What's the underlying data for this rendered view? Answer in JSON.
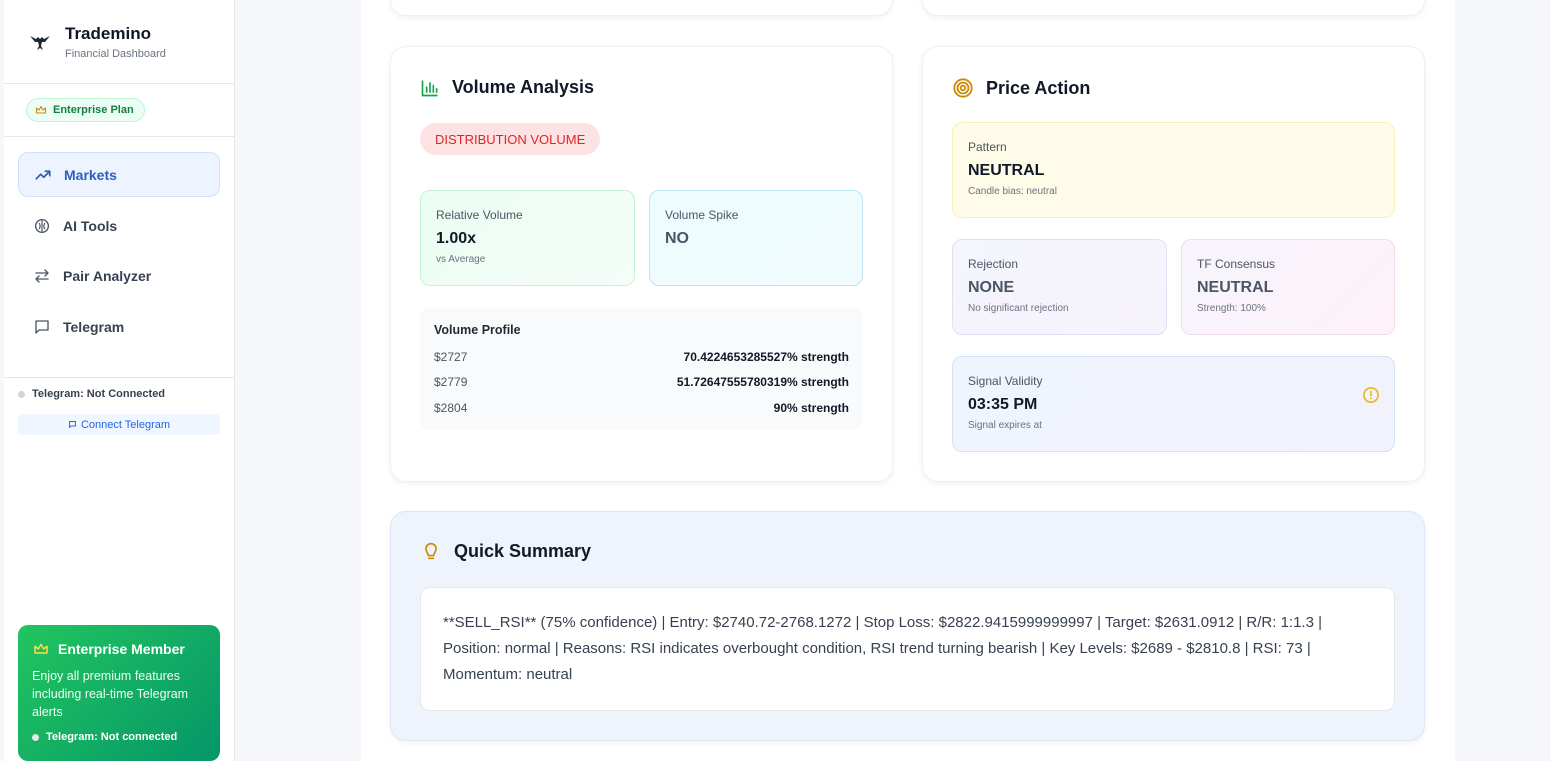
{
  "app": {
    "name": "Trademino",
    "subtitle": "Financial Dashboard",
    "plan_badge": "Enterprise Plan"
  },
  "sidebar": {
    "items": [
      {
        "label": "Markets",
        "icon": "trending-up-icon",
        "active": true
      },
      {
        "label": "AI Tools",
        "icon": "brain-icon",
        "active": false
      },
      {
        "label": "Pair Analyzer",
        "icon": "arrows-swap-icon",
        "active": false
      },
      {
        "label": "Telegram",
        "icon": "message-square-icon",
        "active": false
      }
    ],
    "telegram_status": "Telegram: Not Connected",
    "connect_label": "Connect Telegram"
  },
  "member_card": {
    "title": "Enterprise Member",
    "description": "Enjoy all premium features including real-time Telegram alerts",
    "status": "Telegram: Not connected"
  },
  "volume_analysis": {
    "title": "Volume Analysis",
    "badge": "DISTRIBUTION VOLUME",
    "relative_volume": {
      "label": "Relative Volume",
      "value": "1.00x",
      "sub": "vs Average"
    },
    "volume_spike": {
      "label": "Volume Spike",
      "value": "NO"
    },
    "profile": {
      "title": "Volume Profile",
      "rows": [
        {
          "price": "$2727",
          "strength": "70.4224653285527% strength"
        },
        {
          "price": "$2779",
          "strength": "51.72647555780319% strength"
        },
        {
          "price": "$2804",
          "strength": "90% strength"
        }
      ]
    }
  },
  "price_action": {
    "title": "Price Action",
    "pattern": {
      "label": "Pattern",
      "value": "NEUTRAL",
      "sub": "Candle bias: neutral"
    },
    "rejection": {
      "label": "Rejection",
      "value": "NONE",
      "sub": "No significant rejection"
    },
    "tf_consensus": {
      "label": "TF Consensus",
      "value": "NEUTRAL",
      "sub": "Strength: 100%"
    },
    "signal_validity": {
      "label": "Signal Validity",
      "value": "03:35 PM",
      "sub": "Signal expires at"
    }
  },
  "quick_summary": {
    "title": "Quick Summary",
    "text": "**SELL_RSI** (75% confidence) | Entry: $2740.72-2768.1272 | Stop Loss: $2822.9415999999997 | Target: $2631.0912 | R/R: 1:1.3 | Position: normal | Reasons: RSI indicates overbought condition, RSI trend turning bearish | Key Levels: $2689 - $2810.8 | RSI: 73 | Momentum: neutral"
  },
  "colors": {
    "accent_blue": "#2e5fb8",
    "green": "#16a34a",
    "red": "#dc2626",
    "amber": "#ca8a04"
  }
}
